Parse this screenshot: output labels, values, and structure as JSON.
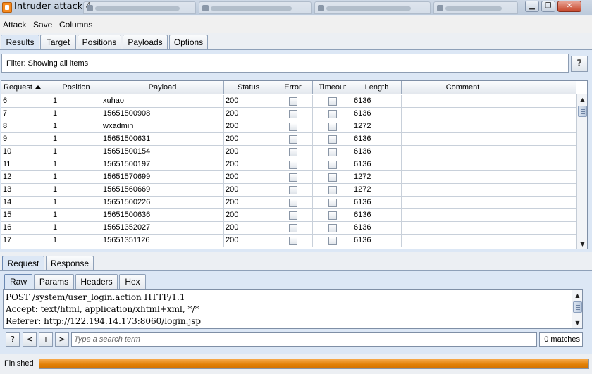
{
  "window": {
    "title": "Intruder attack 4",
    "controls": {
      "minimize": "▁",
      "restore": "❐",
      "close": "✕"
    }
  },
  "menu": [
    "Attack",
    "Save",
    "Columns"
  ],
  "main_tabs": [
    {
      "label": "Results",
      "active": true
    },
    {
      "label": "Target",
      "active": false
    },
    {
      "label": "Positions",
      "active": false
    },
    {
      "label": "Payloads",
      "active": false
    },
    {
      "label": "Options",
      "active": false
    }
  ],
  "filter": {
    "text": "Filter:  Showing all items",
    "help": "?"
  },
  "table": {
    "sort_column": "Request",
    "sort_direction": "ascending",
    "columns": [
      "Request",
      "Position",
      "Payload",
      "Status",
      "Error",
      "Timeout",
      "Length",
      "Comment"
    ],
    "rows": [
      {
        "request": "6",
        "position": "1",
        "payload": "xuhao",
        "status": "200",
        "error": false,
        "timeout": false,
        "length": "6136",
        "comment": ""
      },
      {
        "request": "7",
        "position": "1",
        "payload": "15651500908",
        "status": "200",
        "error": false,
        "timeout": false,
        "length": "6136",
        "comment": ""
      },
      {
        "request": "8",
        "position": "1",
        "payload": "wxadmin",
        "status": "200",
        "error": false,
        "timeout": false,
        "length": "1272",
        "comment": ""
      },
      {
        "request": "9",
        "position": "1",
        "payload": "15651500631",
        "status": "200",
        "error": false,
        "timeout": false,
        "length": "6136",
        "comment": ""
      },
      {
        "request": "10",
        "position": "1",
        "payload": "15651500154",
        "status": "200",
        "error": false,
        "timeout": false,
        "length": "6136",
        "comment": ""
      },
      {
        "request": "11",
        "position": "1",
        "payload": "15651500197",
        "status": "200",
        "error": false,
        "timeout": false,
        "length": "6136",
        "comment": ""
      },
      {
        "request": "12",
        "position": "1",
        "payload": "15651570699",
        "status": "200",
        "error": false,
        "timeout": false,
        "length": "1272",
        "comment": ""
      },
      {
        "request": "13",
        "position": "1",
        "payload": "15651560669",
        "status": "200",
        "error": false,
        "timeout": false,
        "length": "1272",
        "comment": ""
      },
      {
        "request": "14",
        "position": "1",
        "payload": "15651500226",
        "status": "200",
        "error": false,
        "timeout": false,
        "length": "6136",
        "comment": ""
      },
      {
        "request": "15",
        "position": "1",
        "payload": "15651500636",
        "status": "200",
        "error": false,
        "timeout": false,
        "length": "6136",
        "comment": ""
      },
      {
        "request": "16",
        "position": "1",
        "payload": "15651352027",
        "status": "200",
        "error": false,
        "timeout": false,
        "length": "6136",
        "comment": ""
      },
      {
        "request": "17",
        "position": "1",
        "payload": "15651351126",
        "status": "200",
        "error": false,
        "timeout": false,
        "length": "6136",
        "comment": ""
      }
    ]
  },
  "detail_tabs": [
    {
      "label": "Request",
      "active": true
    },
    {
      "label": "Response",
      "active": false
    }
  ],
  "view_tabs": [
    {
      "label": "Raw",
      "active": true
    },
    {
      "label": "Params",
      "active": false
    },
    {
      "label": "Headers",
      "active": false
    },
    {
      "label": "Hex",
      "active": false
    }
  ],
  "raw_lines": [
    "POST /system/user_login.action HTTP/1.1",
    "Accept: text/html, application/xhtml+xml, */*",
    "Referer: http://122.194.14.173:8060/login.jsp"
  ],
  "search": {
    "buttons": [
      "?",
      "<",
      "+",
      ">"
    ],
    "placeholder": "Type a search term",
    "matches": "0 matches"
  },
  "status": {
    "text": "Finished",
    "progress": 1.0,
    "progress_color": "#e07f06"
  }
}
